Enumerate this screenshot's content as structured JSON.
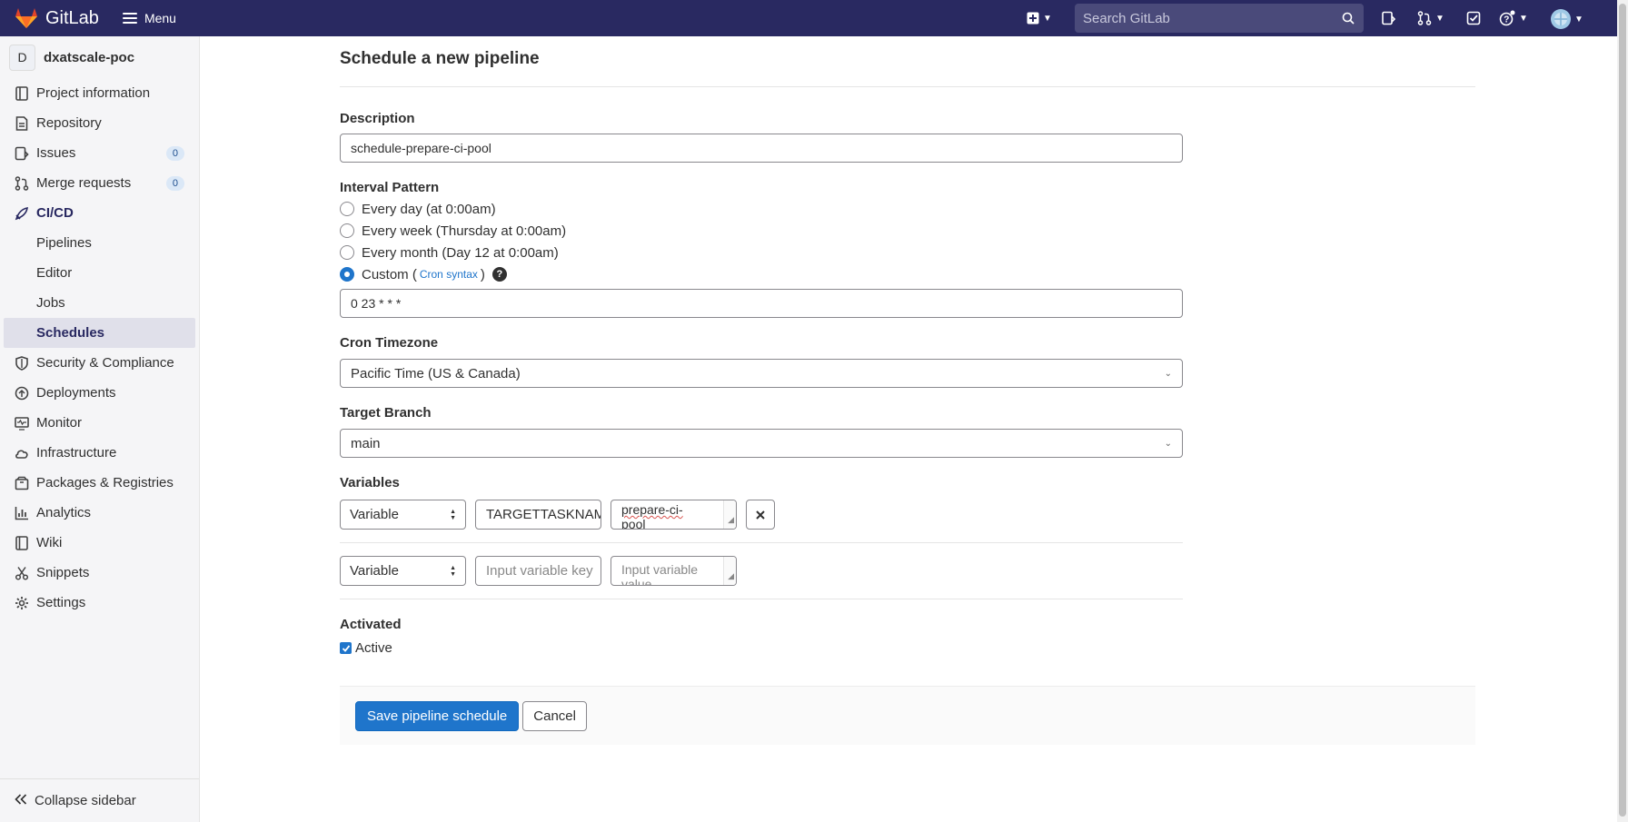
{
  "header": {
    "brand": "GitLab",
    "menu_label": "Menu",
    "search_placeholder": "Search GitLab"
  },
  "sidebar": {
    "project_initial": "D",
    "project_name": "dxatscale-poc",
    "items": [
      {
        "label": "Project information",
        "icon": "project-information-icon"
      },
      {
        "label": "Repository",
        "icon": "repository-icon"
      },
      {
        "label": "Issues",
        "icon": "issues-icon",
        "count": "0"
      },
      {
        "label": "Merge requests",
        "icon": "merge-request-icon",
        "count": "0"
      },
      {
        "label": "CI/CD",
        "icon": "rocket-icon"
      },
      {
        "label": "Security & Compliance",
        "icon": "shield-icon"
      },
      {
        "label": "Deployments",
        "icon": "deployments-icon"
      },
      {
        "label": "Monitor",
        "icon": "monitor-icon"
      },
      {
        "label": "Infrastructure",
        "icon": "cloud-icon"
      },
      {
        "label": "Packages & Registries",
        "icon": "package-icon"
      },
      {
        "label": "Analytics",
        "icon": "chart-icon"
      },
      {
        "label": "Wiki",
        "icon": "book-icon"
      },
      {
        "label": "Snippets",
        "icon": "scissors-icon"
      },
      {
        "label": "Settings",
        "icon": "gear-icon"
      }
    ],
    "cicd_sub": [
      "Pipelines",
      "Editor",
      "Jobs",
      "Schedules"
    ],
    "collapse_label": "Collapse sidebar"
  },
  "form": {
    "title": "Schedule a new pipeline",
    "description_label": "Description",
    "description_value": "schedule-prepare-ci-pool",
    "interval_label": "Interval Pattern",
    "interval_options": [
      "Every day (at 0:00am)",
      "Every week (Thursday at 0:00am)",
      "Every month (Day 12 at 0:00am)"
    ],
    "custom_label": "Custom (",
    "cron_link": "Cron syntax",
    "custom_close": ")",
    "cron_value": "0 23 * * *",
    "timezone_label": "Cron Timezone",
    "timezone_value": "Pacific Time (US & Canada)",
    "branch_label": "Target Branch",
    "branch_value": "main",
    "variables_label": "Variables",
    "variables": [
      {
        "type": "Variable",
        "key": "TARGETTASKNAM",
        "value_line1": "prepare-ci-",
        "value_line2": "pool"
      },
      {
        "type": "Variable",
        "key_placeholder": "Input variable key",
        "value_placeholder_line1": "Input variable",
        "value_placeholder_line2": "value"
      }
    ],
    "activated_label": "Activated",
    "active_label": "Active",
    "save_label": "Save pipeline schedule",
    "cancel_label": "Cancel"
  }
}
